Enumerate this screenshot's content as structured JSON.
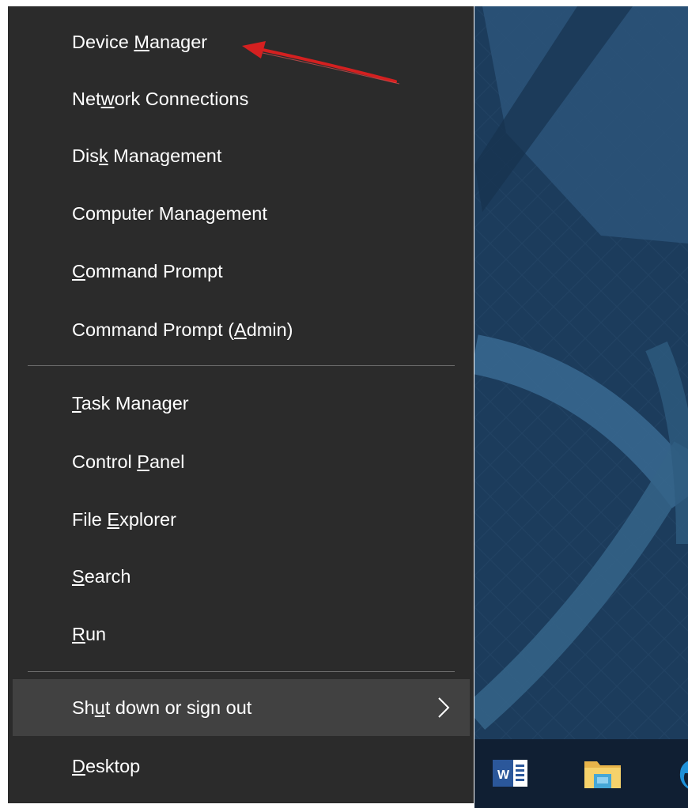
{
  "menu": {
    "group1": [
      {
        "pre": "Device ",
        "u": "M",
        "post": "anager"
      },
      {
        "pre": "Net",
        "u": "w",
        "post": "ork Connections"
      },
      {
        "pre": "Dis",
        "u": "k",
        "post": " Management"
      },
      {
        "pre": "Computer Mana",
        "u": "g",
        "post": "ement"
      },
      {
        "pre": "",
        "u": "C",
        "post": "ommand Prompt"
      },
      {
        "pre": "Command Prompt (",
        "u": "A",
        "post": "dmin)"
      }
    ],
    "group2": [
      {
        "pre": "",
        "u": "T",
        "post": "ask Manager"
      },
      {
        "pre": "Control ",
        "u": "P",
        "post": "anel"
      },
      {
        "pre": "File ",
        "u": "E",
        "post": "xplorer"
      },
      {
        "pre": "",
        "u": "S",
        "post": "earch"
      },
      {
        "pre": "",
        "u": "R",
        "post": "un"
      }
    ],
    "group3": [
      {
        "pre": "Sh",
        "u": "u",
        "post": "t down or sign out"
      },
      {
        "pre": "",
        "u": "D",
        "post": "esktop"
      }
    ]
  },
  "taskbar": {
    "icons": [
      "word-icon",
      "file-explorer-icon",
      "edge-icon"
    ],
    "word_letter": "W"
  },
  "colors": {
    "menu_bg": "#2b2b2b",
    "menu_selected": "#414141",
    "desktop_bg": "#1c3c5c",
    "annotation_arrow": "#d42020"
  }
}
